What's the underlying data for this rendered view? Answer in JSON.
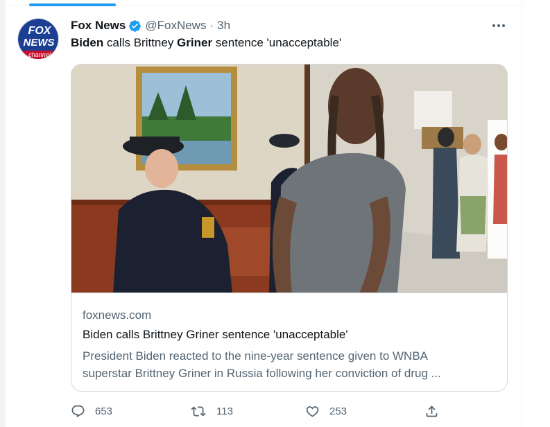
{
  "tweet": {
    "author_name": "Fox News",
    "handle": "@FoxNews",
    "separator": "·",
    "time": "3h",
    "text_parts": [
      "Biden",
      " calls Brittney ",
      "Griner",
      " sentence 'unacceptable'"
    ],
    "avatar": {
      "logo_line1": "FOX",
      "logo_line2": "NEWS",
      "logo_line3": "channel"
    },
    "more_icon": "more-horizontal-icon"
  },
  "card": {
    "domain": "foxnews.com",
    "title": "Biden calls Brittney Griner sentence 'unacceptable'",
    "description_line1": "President Biden reacted to the nine-year sentence given to WNBA",
    "description_line2": "superstar Brittney Griner in Russia following her conviction of drug ..."
  },
  "actions": {
    "reply_count": "653",
    "retweet_count": "113",
    "like_count": "253",
    "share_icon": "share-icon"
  },
  "colors": {
    "accent": "#1d9bf0",
    "text_primary": "#0f1419",
    "text_secondary": "#536471",
    "border": "#cfd9de",
    "fox_blue": "#1c3f94",
    "fox_red": "#c8102e"
  }
}
